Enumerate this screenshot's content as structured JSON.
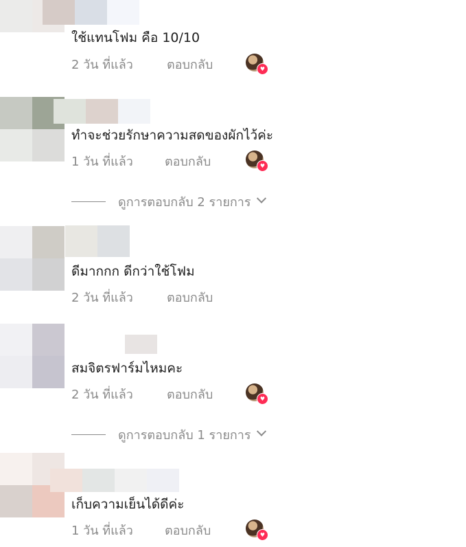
{
  "colors": {
    "text_primary": "#1c1c1c",
    "text_secondary": "#8a8a8a",
    "reaction_heart": "#fe2c55"
  },
  "icons": {
    "reaction": "heart-icon",
    "expand": "chevron-down-icon"
  },
  "comments": [
    {
      "text": "ใช้แทนโฟม คือ 10/10",
      "time": "2 วัน ที่แล้ว",
      "reply_label": "ตอบกลับ",
      "creator_liked": true,
      "avatar_colors": [
        "#d2c3bc",
        "#efe6e2",
        "#ebebea",
        "#ede9e7"
      ],
      "name_colors": [
        "#d6cbc7",
        "#d9dee6",
        "#f4f6fb"
      ]
    },
    {
      "text": "ทำจะช่วยรักษาความสดของผักไว้ค่ะ",
      "time": "1 วัน ที่แล้ว",
      "reply_label": "ตอบกลับ",
      "creator_liked": true,
      "avatar_colors": [
        "#c6c9c2",
        "#9da596",
        "#e8eae7",
        "#dcdcda"
      ],
      "name_colors": [
        "#dfe3dc",
        "#ddd2cd",
        "#f2f4f8"
      ],
      "view_replies": "ดูการตอบกลับ 2 รายการ"
    },
    {
      "text": "ดีมากกก ดีกว่าใช้โฟม",
      "time": "2 วัน ที่แล้ว",
      "reply_label": "ตอบกลับ",
      "creator_liked": false,
      "avatar_colors": [
        "#efeff1",
        "#cfccc6",
        "#e2e3e7",
        "#d1d1d2"
      ],
      "name_colors": [
        "#e8e7e2",
        "#dde0e3"
      ]
    },
    {
      "text": "สมจิตรฟาร์มไหมคะ",
      "time": "2 วัน ที่แล้ว",
      "reply_label": "ตอบกลับ",
      "creator_liked": true,
      "avatar_colors": [
        "#f1f1f4",
        "#cbc8d1",
        "#ededf1",
        "#c6c4cf"
      ],
      "name_colors": [
        "#e8e4e3"
      ],
      "view_replies": "ดูการตอบกลับ 1 รายการ"
    },
    {
      "text": "เก็บความเย็นได้ดีค่ะ",
      "time": "1 วัน ที่แล้ว",
      "reply_label": "ตอบกลับ",
      "creator_liked": true,
      "avatar_colors": [
        "#f7f1ee",
        "#eee6e3",
        "#d9d1cd",
        "#ecc9bf"
      ],
      "name_colors": [
        "#f1e1db",
        "#e3e6e5",
        "#f1f1f1",
        "#eff0f5"
      ]
    }
  ]
}
